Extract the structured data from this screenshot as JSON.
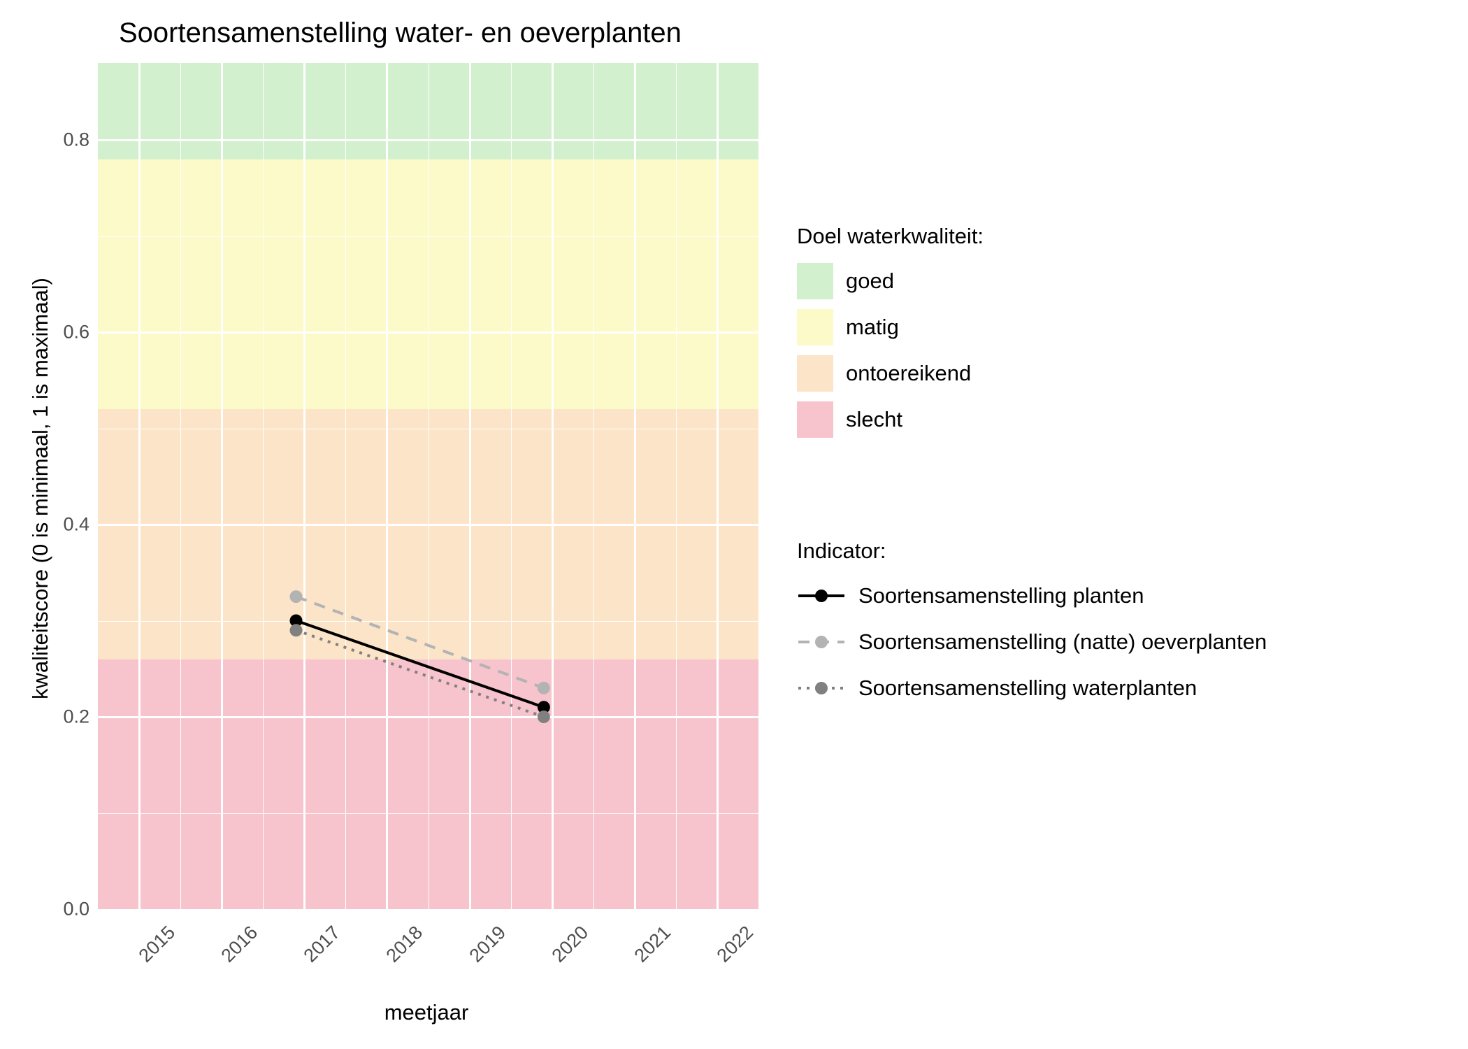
{
  "chart_data": {
    "type": "line",
    "title": "Soortensamenstelling water- en oeverplanten",
    "xlabel": "meetjaar",
    "ylabel": "kwaliteitscore (0 is minimaal, 1 is maximaal)",
    "xlim": [
      2014.5,
      2022.5
    ],
    "ylim": [
      0.0,
      0.88
    ],
    "x_ticks": [
      2015,
      2016,
      2017,
      2018,
      2019,
      2020,
      2021,
      2022
    ],
    "y_ticks": [
      0.0,
      0.2,
      0.4,
      0.6,
      0.8
    ],
    "bands": [
      {
        "name": "slecht",
        "from": 0.0,
        "to": 0.26,
        "color": "#f7c3cd"
      },
      {
        "name": "ontoereikend",
        "from": 0.26,
        "to": 0.52,
        "color": "#fbe4c7"
      },
      {
        "name": "matig",
        "from": 0.52,
        "to": 0.78,
        "color": "#fbfac8"
      },
      {
        "name": "goed",
        "from": 0.78,
        "to": 0.88,
        "color": "#d2f0ce"
      }
    ],
    "series": [
      {
        "name": "Soortensamenstelling planten",
        "color": "#000000",
        "dash": "solid",
        "x": [
          2016.9,
          2019.9
        ],
        "y": [
          0.3,
          0.21
        ]
      },
      {
        "name": "Soortensamenstelling (natte) oeverplanten",
        "color": "#b3b3b3",
        "dash": "dashed",
        "x": [
          2016.9,
          2019.9
        ],
        "y": [
          0.325,
          0.23
        ]
      },
      {
        "name": "Soortensamenstelling waterplanten",
        "color": "#808080",
        "dash": "dotted",
        "x": [
          2016.9,
          2019.9
        ],
        "y": [
          0.29,
          0.2
        ]
      }
    ],
    "legend_bands_title": "Doel waterkwaliteit:",
    "legend_bands": [
      {
        "label": "goed",
        "color": "#d2f0ce"
      },
      {
        "label": "matig",
        "color": "#fbfac8"
      },
      {
        "label": "ontoereikend",
        "color": "#fbe4c7"
      },
      {
        "label": "slecht",
        "color": "#f7c3cd"
      }
    ],
    "legend_series_title": "Indicator:"
  }
}
